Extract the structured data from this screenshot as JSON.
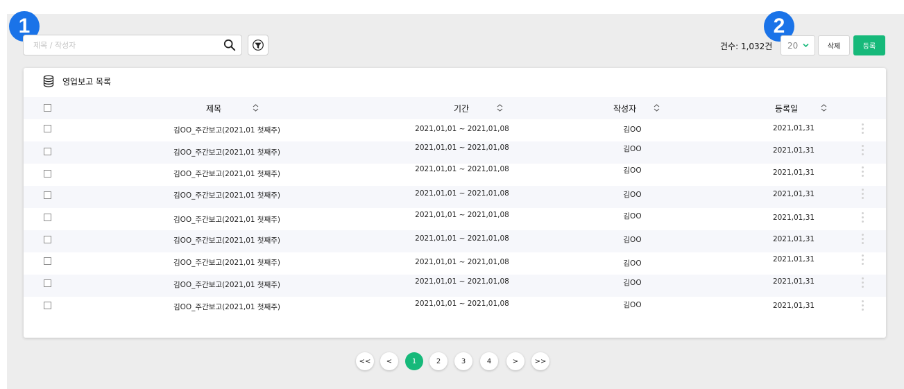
{
  "markers": {
    "first": "1",
    "second": "2"
  },
  "search": {
    "placeholder": "제목 / 작성자",
    "value": ""
  },
  "toolbar": {
    "count_label": "건수: 1,032건",
    "page_size": "20",
    "delete_label": "삭제",
    "register_label": "등록"
  },
  "card": {
    "title": "영업보고 목록"
  },
  "columns": {
    "title": "제목",
    "period": "기간",
    "author": "작성자",
    "date": "등록일"
  },
  "rows": [
    {
      "title": "김OO_주간보고(2021,01 첫째주)",
      "period": "2021,01,01 ~ 2021,01,08",
      "author": "김OO",
      "date": "2021,01,31"
    },
    {
      "title": "김OO_주간보고(2021,01 첫째주)",
      "period": "2021,01,01 ~ 2021,01,08",
      "author": "김OO",
      "date": "2021,01,31"
    },
    {
      "title": "김OO_주간보고(2021,01 첫째주)",
      "period": "2021,01,01 ~ 2021,01,08",
      "author": "김OO",
      "date": "2021,01,31"
    },
    {
      "title": "김OO_주간보고(2021,01 첫째주)",
      "period": "2021,01,01 ~ 2021,01,08",
      "author": "김OO",
      "date": "2021,01,31"
    },
    {
      "title": "김OO_주간보고(2021,01 첫째주)",
      "period": "2021,01,01 ~ 2021,01,08",
      "author": "김OO",
      "date": "2021,01,31"
    },
    {
      "title": "김OO_주간보고(2021,01 첫째주)",
      "period": "2021,01,01 ~ 2021,01,08",
      "author": "김OO",
      "date": "2021,01,31"
    },
    {
      "title": "김OO_주간보고(2021,01 첫째주)",
      "period": "2021,01,01 ~ 2021,01,08",
      "author": "김OO",
      "date": "2021,01,31"
    },
    {
      "title": "김OO_주간보고(2021,01 첫째주)",
      "period": "2021,01,01 ~ 2021,01,08",
      "author": "김OO",
      "date": "2021,01,31"
    },
    {
      "title": "김OO_주간보고(2021,01 첫째주)",
      "period": "2021,01,01 ~ 2021,01,08",
      "author": "김OO",
      "date": "2021,01,31"
    }
  ],
  "pagination": {
    "first": "<<",
    "prev": "<",
    "next": ">",
    "last": ">>",
    "pages": [
      "1",
      "2",
      "3",
      "4"
    ],
    "current": "1"
  },
  "colors": {
    "accent": "#16b97a",
    "marker": "#1a73e8",
    "stripe": "#f6f7fb",
    "background": "#ededed"
  },
  "icons": [
    "search-icon",
    "filter-icon",
    "chevron-down-icon",
    "database-icon",
    "sort-icon",
    "more-vertical-icon"
  ]
}
